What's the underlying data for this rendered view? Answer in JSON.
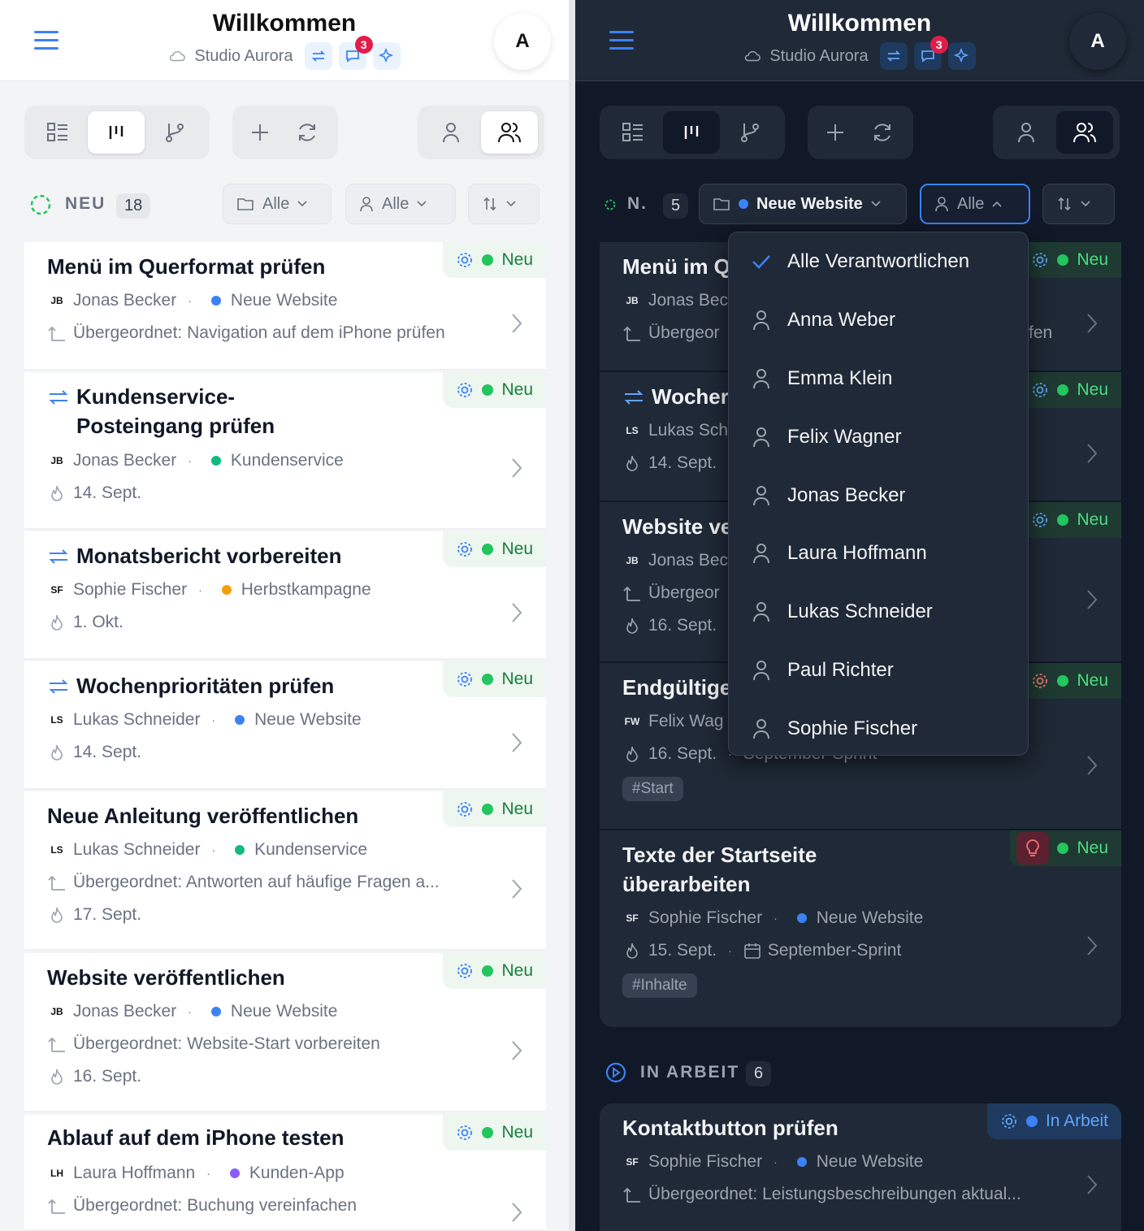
{
  "header": {
    "title": "Willkommen",
    "subtitle": "Studio Aurora",
    "notification_count": "3",
    "avatar_initial": "A"
  },
  "left": {
    "section": {
      "title": "NEU",
      "count": "18"
    },
    "filters": {
      "project": "Alle",
      "assignee": "Alle"
    },
    "cards": [
      {
        "title": "Menü im Querformat prüfen",
        "initials": "JB",
        "person": "Jonas Becker",
        "project": "Neue Website",
        "project_color": "#3b82f6",
        "parent": "Übergeordnet: Navigation auf dem iPhone prüfen",
        "status": "Neu"
      },
      {
        "title_line1": "Kundenservice-",
        "title_line2": "Posteingang prüfen",
        "initials": "JB",
        "person": "Jonas Becker",
        "project": "Kundenservice",
        "project_color": "#10b981",
        "date": "14. Sept.",
        "status": "Neu"
      },
      {
        "title": "Monatsbericht vorbereiten",
        "initials": "SF",
        "person": "Sophie Fischer",
        "project": "Herbstkampagne",
        "project_color": "#f59e0b",
        "date": "1. Okt.",
        "status": "Neu"
      },
      {
        "title": "Wochenprioritäten prüfen",
        "initials": "LS",
        "person": "Lukas Schneider",
        "project": "Neue Website",
        "project_color": "#3b82f6",
        "date": "14. Sept.",
        "status": "Neu"
      },
      {
        "title": "Neue Anleitung veröffentlichen",
        "initials": "LS",
        "person": "Lukas Schneider",
        "project": "Kundenservice",
        "project_color": "#10b981",
        "parent": "Übergeordnet: Antworten auf häufige Fragen a...",
        "date": "17. Sept.",
        "status": "Neu"
      },
      {
        "title": "Website veröffentlichen",
        "initials": "JB",
        "person": "Jonas Becker",
        "project": "Neue Website",
        "project_color": "#3b82f6",
        "parent": "Übergeordnet: Website-Start vorbereiten",
        "date": "16. Sept.",
        "status": "Neu"
      },
      {
        "title": "Ablauf auf dem iPhone testen",
        "initials": "LH",
        "person": "Laura Hoffmann",
        "project": "Kunden-App",
        "project_color": "#8b5cf6",
        "parent": "Übergeordnet: Buchung vereinfachen",
        "status": "Neu"
      }
    ]
  },
  "right": {
    "section": {
      "title": "N.",
      "count": "5"
    },
    "filters": {
      "project": "Neue Website",
      "assignee": "Alle"
    },
    "cards": [
      {
        "title": "Menü im Q",
        "initials": "JB",
        "person": "Jonas Bec",
        "parent": "Übergeor",
        "parent_tail": "fen",
        "status": "Neu"
      },
      {
        "title": "Wocher",
        "initials": "LS",
        "person": "Lukas Sch",
        "date": "14. Sept.",
        "status": "Neu"
      },
      {
        "title": "Website ve",
        "initials": "JB",
        "person": "Jonas Bec",
        "parent": "Übergeor",
        "date": "16. Sept.",
        "status": "Neu"
      },
      {
        "title": "Endgültige",
        "initials": "FW",
        "person": "Felix Wag",
        "date": "16. Sept.",
        "sprint_partial": "September-Sprint",
        "tag": "#Start",
        "status": "Neu"
      },
      {
        "title_line1": "Texte der Startseite",
        "title_line2": "überarbeiten",
        "initials": "SF",
        "person": "Sophie Fischer",
        "project": "Neue Website",
        "date": "15. Sept.",
        "sprint": "September-Sprint",
        "tag": "#Inhalte",
        "status": "Neu"
      }
    ],
    "section2": {
      "title": "IN ARBEIT",
      "count": "6"
    },
    "card_in_progress": {
      "title": "Kontaktbutton prüfen",
      "initials": "SF",
      "person": "Sophie Fischer",
      "project": "Neue Website",
      "parent": "Übergeordnet: Leistungsbeschreibungen aktual...",
      "status": "In Arbeit"
    },
    "dropdown": {
      "items": [
        "Alle Verantwortlichen",
        "Anna Weber",
        "Emma Klein",
        "Felix Wagner",
        "Jonas Becker",
        "Laura Hoffmann",
        "Lukas Schneider",
        "Paul Richter",
        "Sophie Fischer"
      ]
    }
  },
  "colors": {
    "accent": "#3b82f6",
    "status_new": "#22c55e",
    "badge": "#e11d48"
  }
}
